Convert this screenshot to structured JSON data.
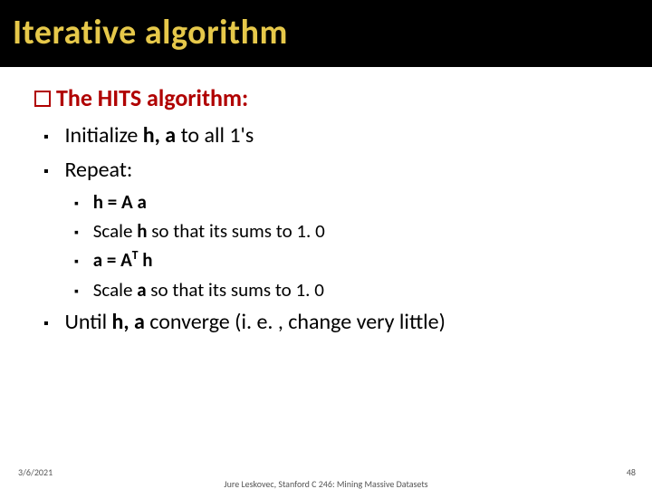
{
  "slide": {
    "title": "Iterative algorithm",
    "heading": "The HITS algorithm:",
    "bullets": {
      "b1_pre": "Initialize ",
      "b1_bold": "h, a",
      "b1_post": " to all 1's",
      "b2": "Repeat:",
      "s1_bold": "h = A a",
      "s2_pre": "Scale ",
      "s2_bold": "h",
      "s2_post": " so that its sums to 1. 0",
      "s3_a": "a = A",
      "s3_sup": "T",
      "s3_b": " h",
      "s4_pre": "Scale ",
      "s4_bold": "a",
      "s4_post": " so that its sums to 1. 0",
      "b3_pre": "Until ",
      "b3_bold": "h, a",
      "b3_post": " converge (i. e. , change very little)"
    }
  },
  "footer": {
    "date": "3/6/2021",
    "center": "Jure Leskovec, Stanford C 246: Mining Massive Datasets",
    "page": "48"
  }
}
